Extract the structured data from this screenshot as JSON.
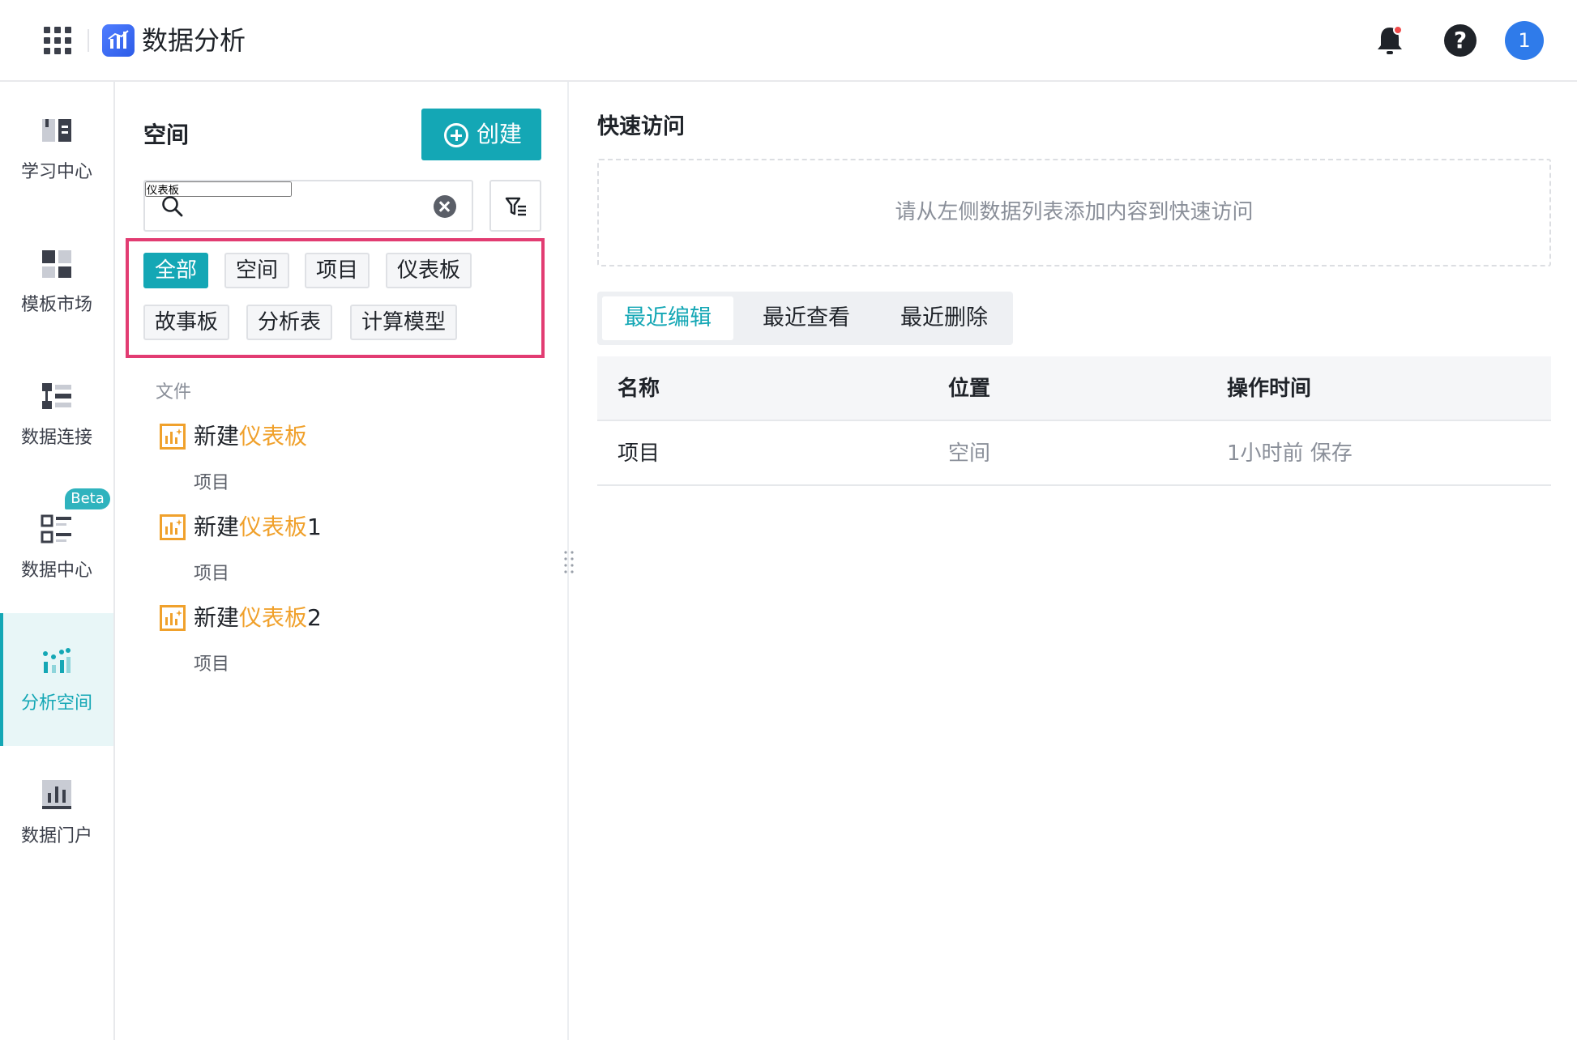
{
  "app": {
    "title": "数据分析",
    "avatar_text": "1"
  },
  "nav": {
    "items": [
      {
        "label": "学习中心",
        "icon": "book-icon"
      },
      {
        "label": "模板市场",
        "icon": "template-icon"
      },
      {
        "label": "数据连接",
        "icon": "data-connect-icon"
      },
      {
        "label": "数据中心",
        "icon": "data-center-icon",
        "badge": "Beta"
      },
      {
        "label": "分析空间",
        "icon": "analysis-space-icon",
        "active": true
      },
      {
        "label": "数据门户",
        "icon": "data-portal-icon"
      }
    ]
  },
  "space": {
    "title": "空间",
    "create_label": "创建",
    "search_value": "仪表板",
    "tags": [
      {
        "label": "全部",
        "active": true
      },
      {
        "label": "空间"
      },
      {
        "label": "项目"
      },
      {
        "label": "仪表板"
      },
      {
        "label": "故事板"
      },
      {
        "label": "分析表"
      },
      {
        "label": "计算模型"
      }
    ],
    "file_header": "文件",
    "files": [
      {
        "prefix": "新建",
        "highlight": "仪表板",
        "suffix": "",
        "location": "项目"
      },
      {
        "prefix": "新建",
        "highlight": "仪表板",
        "suffix": "1",
        "location": "项目"
      },
      {
        "prefix": "新建",
        "highlight": "仪表板",
        "suffix": "2",
        "location": "项目"
      }
    ]
  },
  "quick_access": {
    "title": "快速访问",
    "empty_text": "请从左侧数据列表添加内容到快速访问"
  },
  "recent": {
    "tabs": [
      {
        "label": "最近编辑",
        "active": true
      },
      {
        "label": "最近查看"
      },
      {
        "label": "最近删除"
      }
    ],
    "columns": [
      "名称",
      "位置",
      "操作时间"
    ],
    "rows": [
      {
        "name": "项目",
        "location": "空间",
        "time": "1小时前 保存"
      }
    ]
  },
  "colors": {
    "accent": "#14a7b5",
    "highlight": "#f0a12c",
    "selection_border": "#e23c72",
    "file_icon": "#f0a12c"
  }
}
